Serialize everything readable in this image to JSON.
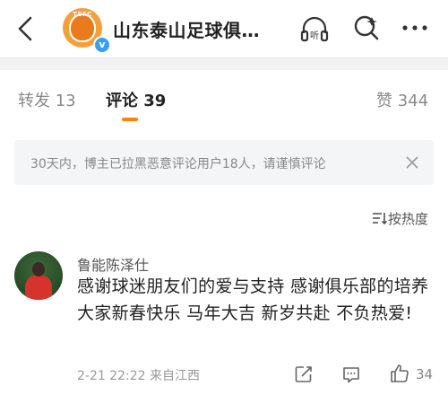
{
  "header": {
    "title": "山东泰山足球俱…",
    "avatar_text": "TSFC",
    "verified_mark": "v",
    "icons": [
      "back-arrow-icon",
      "listen-icon",
      "search-icon",
      "more-icon"
    ]
  },
  "tabs": {
    "repost_label": "转发 13",
    "comment_label": "评论 39",
    "like_label": "赞 344",
    "active": "comment",
    "accent_color": "#ff8200"
  },
  "notice": {
    "text": "30天内，博主已拉黑恶意评论用户18人，请谨慎评论"
  },
  "sort": {
    "label": "按热度"
  },
  "comment": {
    "user": "鲁能陈泽仕",
    "text": "感谢球迷朋友们的爱与支持 感谢俱乐部的培养 大家新春快乐 马年大吉 新岁共赴 不负热爱!",
    "meta": "2-21 22:22  来自江西",
    "like_count": "34"
  }
}
